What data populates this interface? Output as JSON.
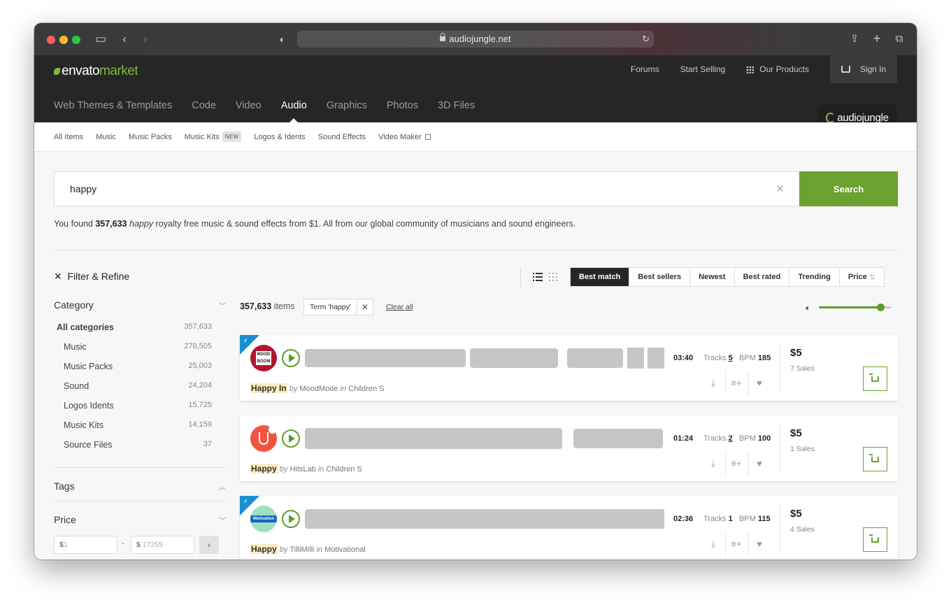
{
  "browser": {
    "url": "audiojungle.net"
  },
  "header": {
    "logo_word": "envato",
    "logo_market": "market",
    "links": [
      "Forums",
      "Start Selling",
      "Our Products"
    ],
    "signin": "Sign In",
    "nav": [
      "Web Themes & Templates",
      "Code",
      "Video",
      "Audio",
      "Graphics",
      "Photos",
      "3D Files"
    ],
    "active_nav": "Audio",
    "site_badge": "audiojungle"
  },
  "subnav": {
    "items": [
      "All Items",
      "Music",
      "Music Packs",
      "Music Kits",
      "Logos & Idents",
      "Sound Effects",
      "Video Maker"
    ],
    "new_badge": "NEW"
  },
  "search": {
    "value": "happy",
    "button": "Search"
  },
  "results_text": {
    "prefix": "You found ",
    "count": "357,633",
    "term": "happy",
    "suffix": " royalty free music & sound effects from $1. All from our global community of musicians and sound engineers."
  },
  "filter": {
    "title": "Filter & Refine",
    "category_head": "Category",
    "categories": [
      {
        "name": "All categories",
        "count": "357,633"
      },
      {
        "name": "Music",
        "count": "278,505"
      },
      {
        "name": "Music Packs",
        "count": "25,003"
      },
      {
        "name": "Sound",
        "count": "24,204"
      },
      {
        "name": "Logos Idents",
        "count": "15,725"
      },
      {
        "name": "Music Kits",
        "count": "14,159"
      },
      {
        "name": "Source Files",
        "count": "37"
      }
    ],
    "tags_head": "Tags",
    "price_head": "Price",
    "price_min_placeholder": "1",
    "price_max_placeholder": "17255",
    "currency": "$"
  },
  "sort": {
    "options": [
      "Best match",
      "Best sellers",
      "Newest",
      "Best rated",
      "Trending",
      "Price"
    ],
    "active": "Best match"
  },
  "list": {
    "count": "357,633",
    "count_suffix": " items",
    "chip": "Term 'happy'",
    "clear_all": "Clear all",
    "volume": 0.85
  },
  "tracks": [
    {
      "title": "Happy In",
      "author": "MoodMode",
      "category": "Children S",
      "duration": "03:40",
      "tracks": "5",
      "bpm": "185",
      "price": "$5",
      "sales": "7 Sales",
      "featured": true,
      "thumb": "MOOD BOOM"
    },
    {
      "title": "Happy",
      "author": "HitsLab",
      "category": "Children S",
      "duration": "01:24",
      "tracks": "2",
      "bpm": "100",
      "price": "$5",
      "sales": "1 Sales",
      "featured": false,
      "thumb": ""
    },
    {
      "title": "Happy",
      "author": "TilliMilli",
      "category": "Motivational",
      "duration": "02:36",
      "tracks": "1",
      "bpm": "115",
      "price": "$5",
      "sales": "4 Sales",
      "featured": true,
      "thumb": "Motivation"
    }
  ],
  "labels": {
    "by": "by",
    "in": "in",
    "tracks": "Tracks",
    "bpm": "BPM"
  }
}
